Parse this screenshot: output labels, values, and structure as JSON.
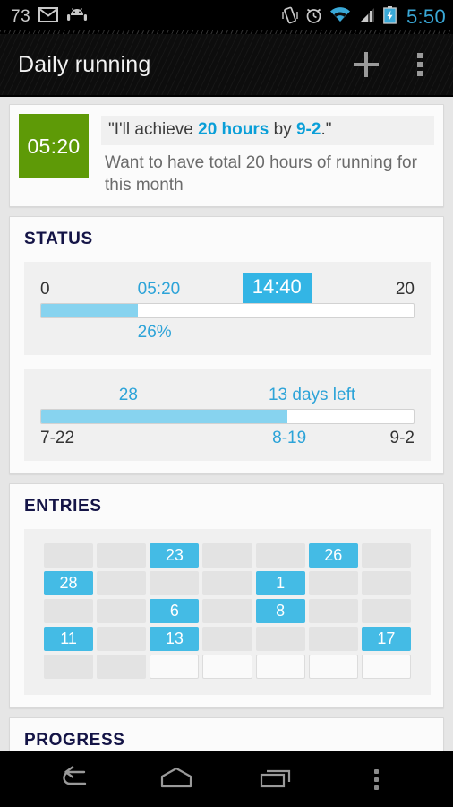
{
  "statusbar": {
    "notification_count": "73",
    "icons": [
      "gmail-icon",
      "android-icon",
      "vibrate-icon",
      "alarm-icon",
      "wifi-icon",
      "signal-icon",
      "battery-charging-icon"
    ],
    "time": "5:50",
    "accent": "#3aa9d8"
  },
  "actionbar": {
    "title": "Daily running",
    "add_label": "+",
    "overflow_label": "More options"
  },
  "goal": {
    "elapsed_time": "05:20",
    "quote_prefix": "\"I'll achieve ",
    "quote_amount": "20 hours",
    "quote_middle": " by ",
    "quote_date": "9-2",
    "quote_suffix": ".\"",
    "description": "Want to have total 20 hours of running for this month",
    "box_color": "#5e9a07"
  },
  "status": {
    "title": "STATUS",
    "amount_bar": {
      "min_label": "0",
      "current_label": "05:20",
      "remaining_badge": "14:40",
      "max_label": "20",
      "percent_label": "26%",
      "percent": 26
    },
    "time_bar": {
      "elapsed_days_label": "28",
      "days_left_label": "13 days left",
      "start_date": "7-22",
      "today_date": "8-19",
      "end_date": "9-2",
      "percent": 66
    }
  },
  "entries": {
    "title": "ENTRIES",
    "columns": 7,
    "cells": [
      {
        "label": "",
        "state": "off"
      },
      {
        "label": "",
        "state": "off"
      },
      {
        "label": "23",
        "state": "on"
      },
      {
        "label": "",
        "state": "off"
      },
      {
        "label": "",
        "state": "off"
      },
      {
        "label": "26",
        "state": "on"
      },
      {
        "label": "",
        "state": "off"
      },
      {
        "label": "28",
        "state": "on"
      },
      {
        "label": "",
        "state": "off"
      },
      {
        "label": "",
        "state": "off"
      },
      {
        "label": "",
        "state": "off"
      },
      {
        "label": "1",
        "state": "on"
      },
      {
        "label": "",
        "state": "off"
      },
      {
        "label": "",
        "state": "off"
      },
      {
        "label": "",
        "state": "off"
      },
      {
        "label": "",
        "state": "off"
      },
      {
        "label": "6",
        "state": "on"
      },
      {
        "label": "",
        "state": "off"
      },
      {
        "label": "8",
        "state": "on"
      },
      {
        "label": "",
        "state": "off"
      },
      {
        "label": "",
        "state": "off"
      },
      {
        "label": "11",
        "state": "on"
      },
      {
        "label": "",
        "state": "off"
      },
      {
        "label": "13",
        "state": "on"
      },
      {
        "label": "",
        "state": "off"
      },
      {
        "label": "",
        "state": "off"
      },
      {
        "label": "",
        "state": "off"
      },
      {
        "label": "17",
        "state": "on"
      },
      {
        "label": "",
        "state": "off"
      },
      {
        "label": "",
        "state": "off"
      },
      {
        "label": "",
        "state": "future"
      },
      {
        "label": "",
        "state": "future"
      },
      {
        "label": "",
        "state": "future"
      },
      {
        "label": "",
        "state": "future"
      },
      {
        "label": "",
        "state": "future"
      }
    ]
  },
  "progress": {
    "title": "PROGRESS"
  },
  "navbar": {
    "back_label": "Back",
    "home_label": "Home",
    "recents_label": "Recent apps",
    "menu_label": "Menu"
  },
  "theme": {
    "accent_blue": "#33b5e5",
    "fill_blue": "#87d3ef",
    "link_blue": "#2ca3d8",
    "green": "#5e9a07",
    "heading_navy": "#141446",
    "page_bg": "#e6e6e6"
  }
}
